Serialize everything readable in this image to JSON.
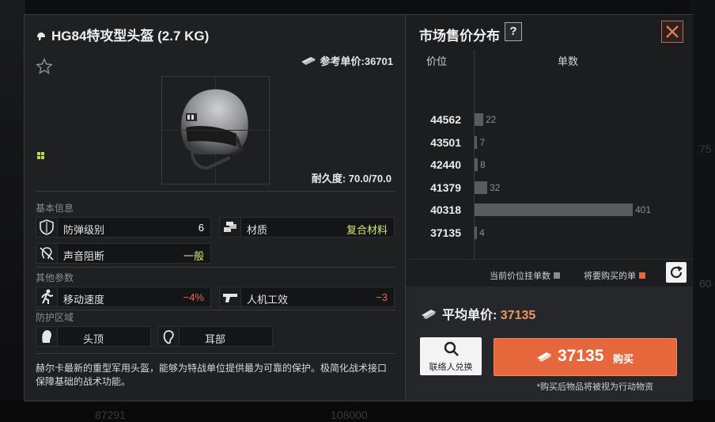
{
  "item": {
    "title": "HG84特攻型头盔 (2.7 KG)",
    "ref_price_label": "参考单价:36701",
    "durability": "耐久度: 70.0/70.0"
  },
  "sections": {
    "basic": "基本信息",
    "other": "其他参数",
    "protect": "防护区域"
  },
  "stats": {
    "armor_label": "防弹级别",
    "armor_value": "6",
    "material_label": "材质",
    "material_value": "复合材料",
    "sound_label": "声音阻断",
    "sound_value": "一般",
    "move_label": "移动速度",
    "move_value": "−4%",
    "ergo_label": "人机工效",
    "ergo_value": "−3",
    "zone_head": "头顶",
    "zone_ear": "耳部"
  },
  "description": "赫尔卡最新的重型军用头盔，能够为特战单位提供最为可靠的保护。极简化战术接口保障基础的战术功能。",
  "market": {
    "title": "市场售价分布",
    "help": "?",
    "col_price": "价位",
    "col_count": "单数",
    "legend_current": "当前价位挂单数",
    "legend_buy": "将要购买的单",
    "avg_label": "平均单价:",
    "avg_value": "37135",
    "contact_label": "联络人兑换",
    "buy_price": "37135",
    "buy_label": "购买",
    "note": "*购买后物品将被视为行动物资"
  },
  "chart_data": {
    "type": "bar",
    "orientation": "horizontal",
    "categories": [
      "44562",
      "43501",
      "42440",
      "41379",
      "40318",
      "37135"
    ],
    "values": [
      22,
      7,
      8,
      32,
      401,
      4
    ],
    "xlabel": "单数",
    "ylabel": "价位"
  },
  "background_text": {
    "a": "87291",
    "b": "108000",
    "c": "75",
    "d": "60"
  },
  "colors": {
    "accent": "#e5673b",
    "bar": "#5a5b5e",
    "legend_current": "#8a8b8e",
    "legend_buy": "#e5673b",
    "armor_value": "#ffffff",
    "material_value": "#d9e87a",
    "sound_value": "#d9e87a",
    "negative": "#e36b4e"
  }
}
